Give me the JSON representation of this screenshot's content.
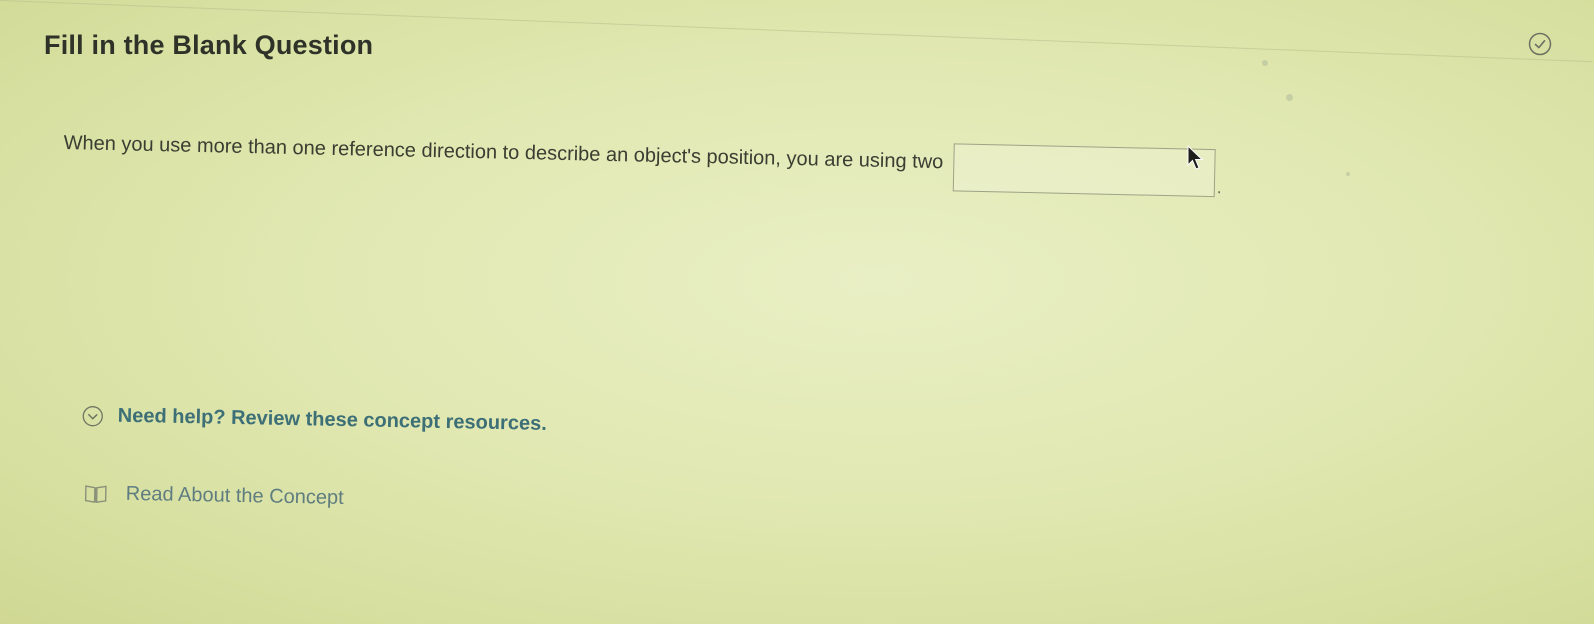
{
  "question": {
    "title": "Fill in the Blank Question",
    "prompt": "When you use more than one reference direction to describe an object's position, you are using two",
    "blank_value": "",
    "trailing_punctuation": "."
  },
  "help": {
    "toggle_label": "Need help? Review these concept resources.",
    "resources": [
      {
        "label": "Read About the Concept",
        "icon": "book-icon"
      }
    ]
  },
  "icons": {
    "status": "check-circle-icon",
    "help_toggle": "chevron-down-circle-icon"
  },
  "colors": {
    "link": "#3d6f76",
    "resource_text": "#5f7d80",
    "title": "#2f3228"
  }
}
